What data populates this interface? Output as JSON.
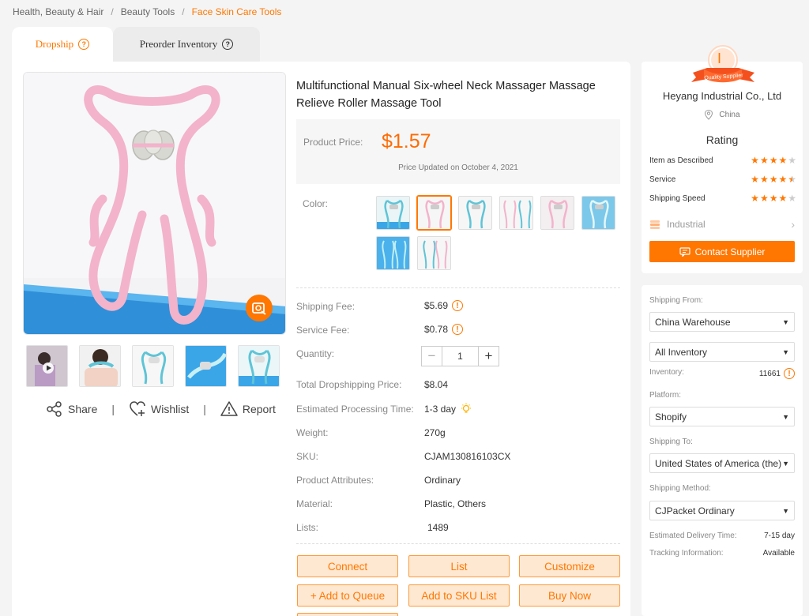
{
  "breadcrumb": [
    "Health, Beauty & Hair",
    "Beauty Tools",
    "Face Skin Care Tools"
  ],
  "tabs": [
    {
      "label": "Dropship",
      "active": true
    },
    {
      "label": "Preorder Inventory",
      "active": false
    }
  ],
  "product": {
    "title": "Multifunctional Manual Six-wheel Neck Massager Massage Relieve Roller Massage Tool",
    "price_label": "Product Price:",
    "price": "$1.57",
    "price_updated": "Price Updated on October 4, 2021",
    "color_label": "Color:",
    "selected_color_index": 1,
    "color_count": 8
  },
  "image_actions": {
    "share": "Share",
    "wishlist": "Wishlist",
    "report": "Report"
  },
  "details": {
    "shipping_fee": {
      "label": "Shipping Fee:",
      "value": "$5.69"
    },
    "service_fee": {
      "label": "Service Fee:",
      "value": "$0.78"
    },
    "quantity": {
      "label": "Quantity:",
      "value": "1"
    },
    "total_price": {
      "label": "Total Dropshipping Price:",
      "value": "$8.04"
    },
    "processing_time": {
      "label": "Estimated Processing Time:",
      "value": "1-3 day"
    },
    "weight": {
      "label": "Weight:",
      "value": "270g"
    },
    "sku": {
      "label": "SKU:",
      "value": "CJAM130816103CX"
    },
    "attributes": {
      "label": "Product Attributes:",
      "value": "Ordinary"
    },
    "material": {
      "label": "Material:",
      "value": "Plastic, Others"
    },
    "lists": {
      "label": "Lists:",
      "value": "1489"
    }
  },
  "buttons": {
    "connect": "Connect",
    "list": "List",
    "customize": "Customize",
    "add_to_queue": "+ Add to Queue",
    "add_to_sku_list": "Add to SKU List",
    "buy_now": "Buy Now"
  },
  "supplier": {
    "badge_letter": "I",
    "badge_ribbon": "Quality Supplier",
    "name": "Heyang Industrial Co., Ltd",
    "country": "China",
    "rating_title": "Rating",
    "ratings": [
      {
        "label": "Item as Described",
        "stars": 4
      },
      {
        "label": "Service",
        "stars": 4.5
      },
      {
        "label": "Shipping Speed",
        "stars": 4
      }
    ],
    "industry": "Industrial",
    "contact_label": "Contact Supplier"
  },
  "shipping": {
    "from_label": "Shipping From:",
    "from_value": "China Warehouse",
    "inventory_select": "All Inventory",
    "inventory_label": "Inventory:",
    "inventory_value": "11661",
    "platform_label": "Platform:",
    "platform_value": "Shopify",
    "to_label": "Shipping To:",
    "to_value": "United States of America (the)",
    "method_label": "Shipping Method:",
    "method_value": "CJPacket Ordinary",
    "delivery_label": "Estimated Delivery Time:",
    "delivery_value": "7-15 day",
    "tracking_label": "Tracking Information:",
    "tracking_value": "Available"
  },
  "colors": {
    "accent": "#ff7700",
    "accent_light": "#ffe8d2",
    "product_pink": "#f4b8cf",
    "product_teal": "#6ec9d8",
    "background": "#f4f4f4"
  }
}
